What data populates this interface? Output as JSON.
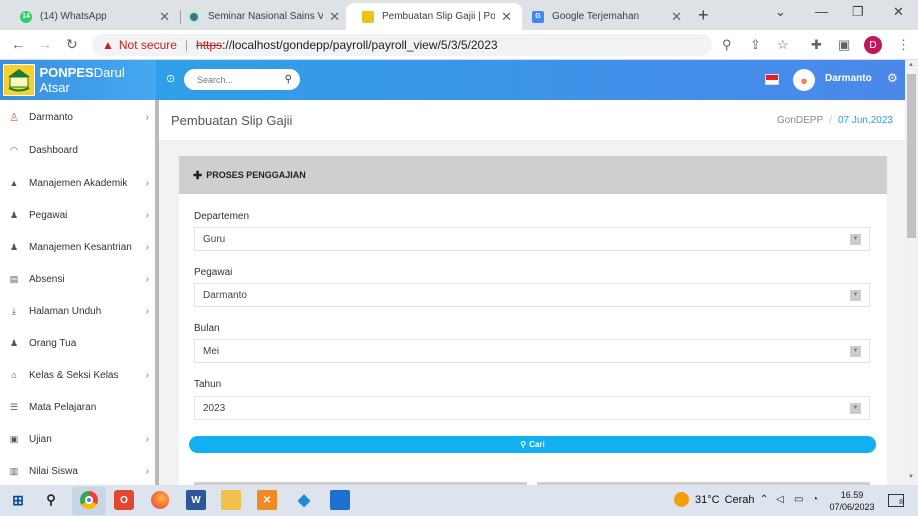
{
  "browser": {
    "tabs": [
      {
        "title": "(14) WhatsApp",
        "favicon": "whatsapp-icon",
        "badge": "14"
      },
      {
        "title": "Seminar Nasional Sains VI – Un",
        "favicon": "globe-icon"
      },
      {
        "title": "Pembuatan Slip Gajii | Pondok",
        "favicon": "pondok-logo-icon",
        "active": true
      },
      {
        "title": "Google Terjemahan",
        "favicon": "google-translate-icon"
      }
    ],
    "new_tab": "+",
    "window_controls": {
      "minimize": "⌄",
      "restore": "—",
      "maximize": "❐",
      "close": "✕"
    },
    "security_text": "Not secure",
    "url_scheme": "https",
    "url_rest": "://localhost/gondepp/payroll/payroll_view/5/3/5/2023",
    "profile_initial": "D"
  },
  "header": {
    "brand_bold": "PONPES",
    "brand_rest": "Darul Atsar",
    "search_placeholder": "Search...",
    "username": "Darmanto",
    "flag": "indonesia"
  },
  "sidebar": {
    "items": [
      {
        "label": "Darmanto",
        "icon": "user-icon",
        "chevron": true
      },
      {
        "label": "Dashboard",
        "icon": "dashboard-icon",
        "chevron": false
      },
      {
        "label": "Manajemen Akademik",
        "icon": "graduation-cap-icon",
        "chevron": true
      },
      {
        "label": "Pegawai",
        "icon": "users-icon",
        "chevron": true
      },
      {
        "label": "Manajemen Kesantrian",
        "icon": "users-icon",
        "chevron": true
      },
      {
        "label": "Absensi",
        "icon": "clipboard-icon",
        "chevron": true
      },
      {
        "label": "Halaman Unduh",
        "icon": "download-icon",
        "chevron": true
      },
      {
        "label": "Orang Tua",
        "icon": "users-icon",
        "chevron": false
      },
      {
        "label": "Kelas & Seksi Kelas",
        "icon": "building-icon",
        "chevron": true
      },
      {
        "label": "Mata Pelajaran",
        "icon": "list-icon",
        "chevron": false
      },
      {
        "label": "Ujian",
        "icon": "briefcase-icon",
        "chevron": true
      },
      {
        "label": "Nilai Siswa",
        "icon": "bar-chart-icon",
        "chevron": true
      }
    ]
  },
  "page": {
    "title": "Pembuatan Slip Gajii",
    "breadcrumb_home": "GonDEPP",
    "breadcrumb_date": "07 Jun,2023"
  },
  "form": {
    "heading": "PROSES PENGGAJIAN",
    "fields": [
      {
        "label": "Departemen",
        "value": "Guru"
      },
      {
        "label": "Pegawai",
        "value": "Darmanto"
      },
      {
        "label": "Bulan",
        "value": "Mei"
      },
      {
        "label": "Tahun",
        "value": "2023"
      }
    ],
    "submit_label": "Cari"
  },
  "taskbar": {
    "weather_temp": "31°C",
    "weather_desc": "Cerah",
    "time": "16.59",
    "date": "07/06/2023",
    "notifications": "8"
  },
  "colors": {
    "header_gradient_start": "#29a5e8",
    "header_gradient_end": "#4b88ea",
    "primary_button": "#12b0f0",
    "date_accent": "#2aa0e0",
    "card_header": "#cfcfcf"
  }
}
